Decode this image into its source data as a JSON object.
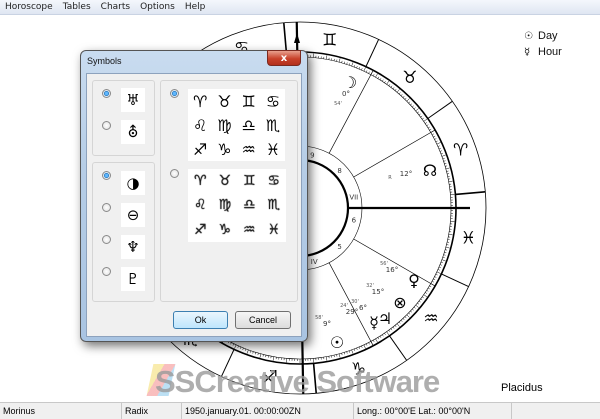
{
  "menu": [
    "Horoscope",
    "Tables",
    "Charts",
    "Options",
    "Help"
  ],
  "legend": {
    "day_icon": "sun-icon",
    "day": "Day",
    "hour_icon": "mercury-icon",
    "hour": "Hour"
  },
  "chart": {
    "signs": [
      "♈",
      "♉",
      "♊",
      "♋",
      "♌",
      "♍",
      "♎",
      "♏",
      "♐",
      "♑",
      "♒",
      "♓"
    ],
    "house_labels": [
      "VII",
      "8",
      "9",
      "6",
      "5",
      "IV"
    ],
    "planets": [
      {
        "name": "moon",
        "glyph": "☽",
        "deg": "0°",
        "min": "54'"
      },
      {
        "name": "node",
        "glyph": "☊",
        "deg": "12°",
        "min": "R"
      },
      {
        "name": "venus",
        "glyph": "♀",
        "deg": "16°",
        "min": "56'"
      },
      {
        "name": "fortune",
        "glyph": "⊗",
        "deg": "15°",
        "min": "32'"
      },
      {
        "name": "jupiter",
        "glyph": "♃",
        "deg": "6°",
        "min": "30'"
      },
      {
        "name": "mercury",
        "glyph": "☿",
        "deg": "29°",
        "min": "24'"
      },
      {
        "name": "sun",
        "glyph": "☉",
        "deg": "9°",
        "min": "58'"
      }
    ],
    "house_system": "Placidus"
  },
  "watermark": "SSCreative Software",
  "status": {
    "app": "Morinus",
    "type": "Radix",
    "date": "1950.january.01. 00:00:00ZN",
    "coords": "Long.: 00°00'E Lat.: 00°00'N"
  },
  "dialog": {
    "title": "Symbols",
    "close": "x",
    "uranus_options": [
      "♅",
      "⛢"
    ],
    "uranus_selected": 0,
    "pluto_options": [
      "◑",
      "⊖",
      "♆",
      "♇"
    ],
    "pluto_selected": 0,
    "zodiac_glyphs": [
      "♈",
      "♉",
      "♊",
      "♋",
      "♌",
      "♍",
      "♎",
      "♏",
      "♐",
      "♑",
      "♒",
      "♓"
    ],
    "zodiac_pictures": [
      "♈",
      "♉",
      "♊",
      "♋",
      "♌",
      "♍",
      "♎",
      "♏",
      "♐",
      "♑",
      "♒",
      "♓"
    ],
    "zodiac_selected": 0,
    "ok": "Ok",
    "cancel": "Cancel"
  }
}
